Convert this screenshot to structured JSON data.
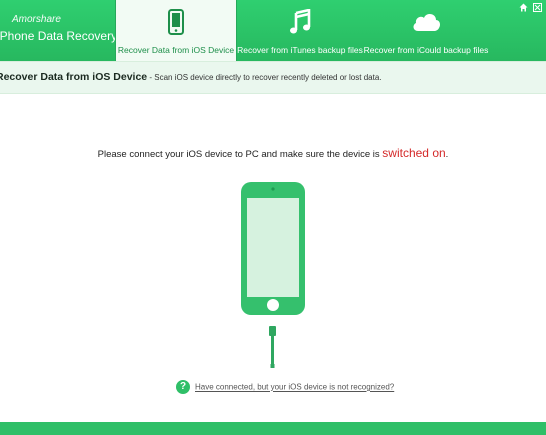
{
  "app": {
    "brand_top": "Amorshare",
    "brand_main": "iPhone Data Recovery"
  },
  "tabs": [
    {
      "label": "Recover Data from iOS Device",
      "icon": "phone-icon",
      "active": true
    },
    {
      "label": "Recover from iTunes backup files",
      "icon": "music-note-icon",
      "active": false
    },
    {
      "label": "Recover from iCould backup files",
      "icon": "cloud-icon",
      "active": false
    }
  ],
  "window": {
    "home_icon": "home-icon",
    "menu_icon": "menu-icon"
  },
  "subheader": {
    "title": "Recover Data from iOS Device",
    "description": " - Scan iOS device directly to recover recently deleted or lost data."
  },
  "main": {
    "instruction_prefix": "Please connect your iOS device to PC and make sure the device is ",
    "instruction_highlight": "switched on",
    "instruction_suffix": "."
  },
  "help": {
    "badge": "?",
    "link": "Have connected, but your iOS device is not recognized?"
  },
  "colors": {
    "accent": "#2fbf68",
    "highlight": "#d42a2a"
  }
}
